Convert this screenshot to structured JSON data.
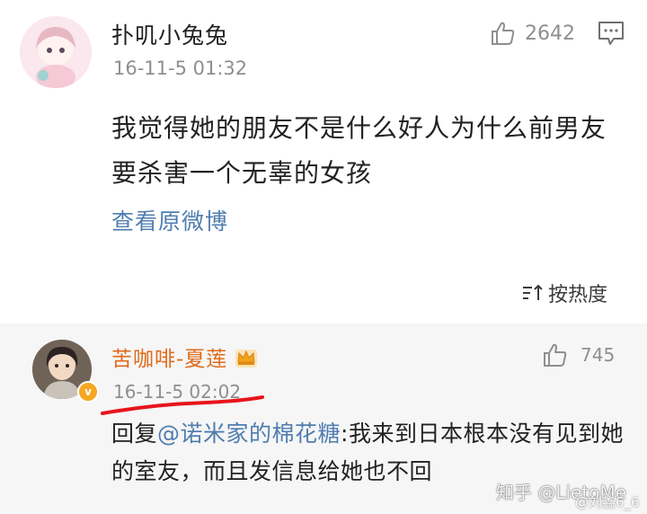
{
  "comments": [
    {
      "username": "扑叽小兔兔",
      "time": "16-11-5 01:32",
      "likes": "2642",
      "text": "我觉得她的朋友不是什么好人为什么前男友要杀害一个无辜的女孩",
      "link": "查看原微博"
    },
    {
      "username": "苦咖啡-夏莲",
      "time": "16-11-5 02:02",
      "likes": "745",
      "reply_prefix": "回复",
      "mention": "@诺米家的棉花糖",
      "text": ":我来到日本根本没有见到她的室友，而且发信息给她也不回"
    }
  ],
  "sort": {
    "label": "按热度"
  },
  "watermark": {
    "line1": "知乎 @LietoMe",
    "line2": "@刘鑫6_6"
  },
  "colors": {
    "link": "#507daf",
    "orange_name": "#e06a1a",
    "gray_meta": "#8f8f8f",
    "red_underline": "#e8141b"
  },
  "icons": [
    "thumbs-up-icon",
    "comment-icon",
    "sort-icon",
    "crown-icon",
    "verified-badge-icon"
  ]
}
